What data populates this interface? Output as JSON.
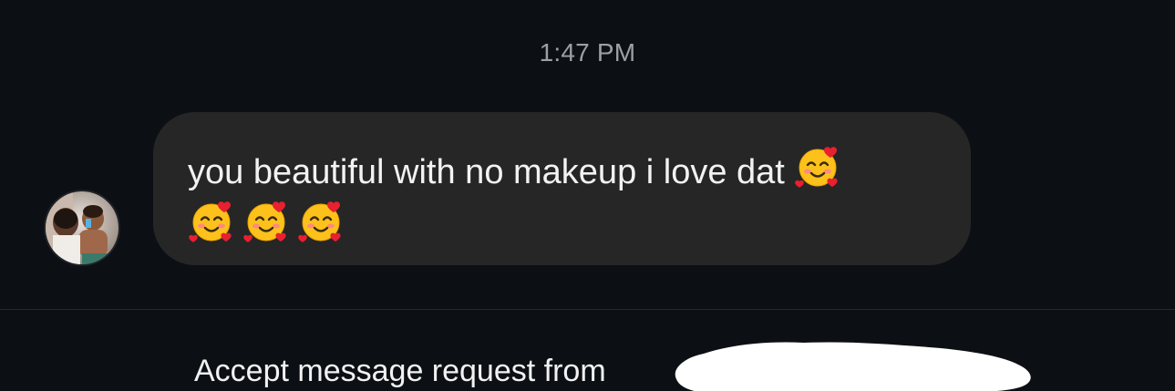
{
  "conversation": {
    "timestamp": "1:47 PM"
  },
  "message": {
    "text": "you beautiful with no makeup i love dat",
    "emoji_name": "smiling-face-with-hearts",
    "emoji_count": 4
  },
  "request_banner": {
    "label": "Accept message request from"
  },
  "colors": {
    "background": "#0c1014",
    "bubble": "#262626",
    "timestamp_text": "#9aa0a6",
    "primary_text": "#f2f2f2",
    "redaction": "#ffffff"
  },
  "icons": {
    "avatar": "sender-avatar",
    "emoji": "smiling-face-with-hearts-icon"
  }
}
